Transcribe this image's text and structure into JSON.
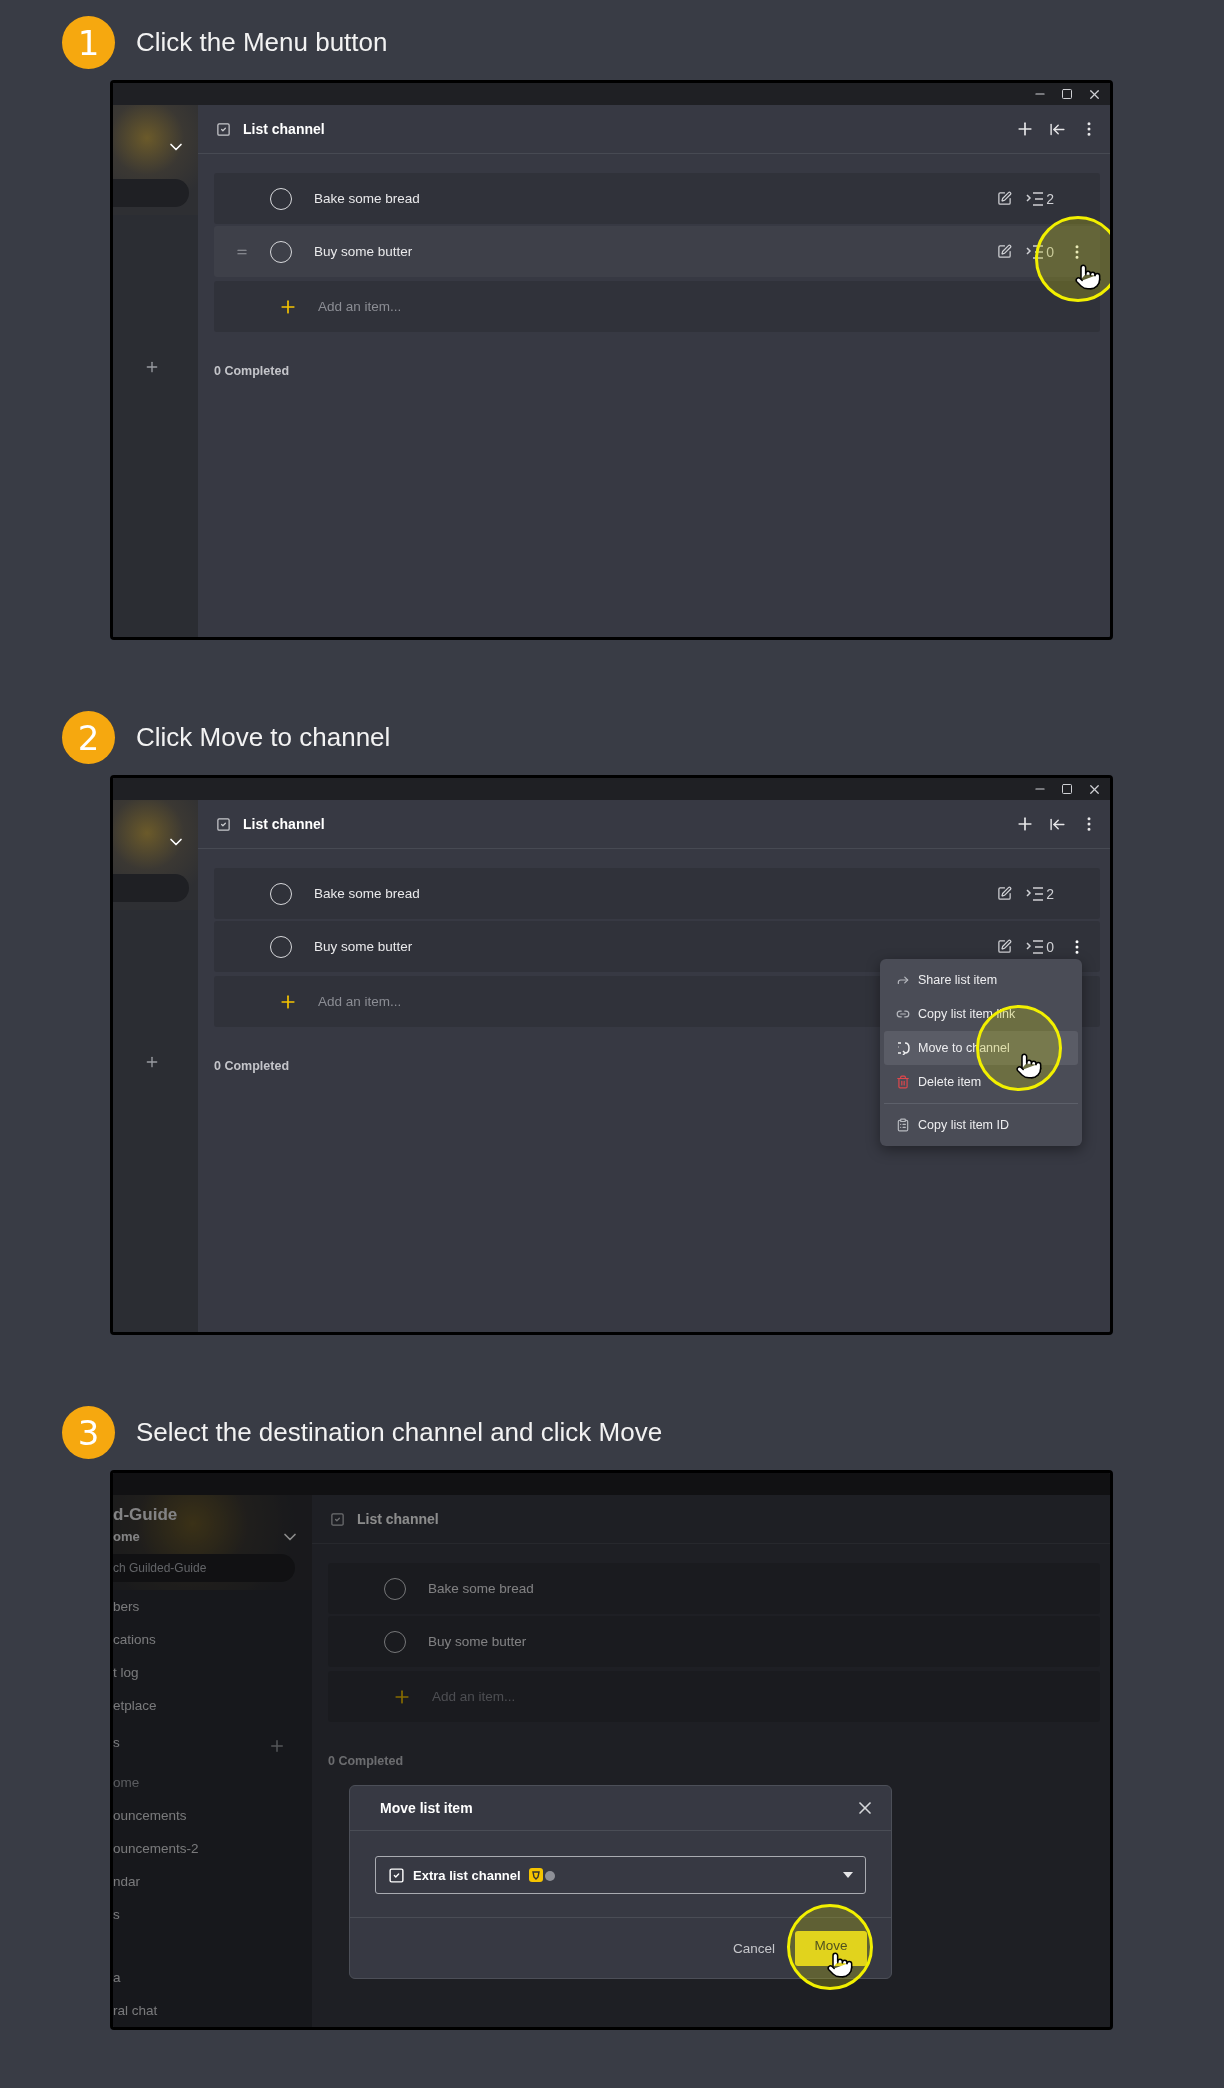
{
  "steps": [
    {
      "number": "1",
      "instruction": "Click the Menu button",
      "screen": {
        "window_controls": true,
        "channel_title": "List channel",
        "header_actions": true,
        "items": [
          {
            "label": "Bake some bread",
            "hovered": false,
            "menu_button": false,
            "click_highlight": false,
            "subtasks": "2"
          },
          {
            "label": "Buy some butter",
            "hovered": true,
            "menu_button": true,
            "click_highlight": true,
            "subtasks": "0"
          }
        ],
        "add_placeholder": "Add an item...",
        "completed": "0 Completed"
      }
    },
    {
      "number": "2",
      "instruction": "Click Move to channel",
      "screen": {
        "window_controls": true,
        "channel_title": "List channel",
        "header_actions": true,
        "items": [
          {
            "label": "Bake some bread",
            "hovered": false,
            "menu_button": false,
            "click_highlight": false,
            "subtasks": "2"
          },
          {
            "label": "Buy some butter",
            "hovered": false,
            "menu_button": true,
            "click_highlight": false,
            "subtasks": "0"
          }
        ],
        "add_placeholder": "Add an item...",
        "completed": "0 Completed",
        "menu": {
          "items": [
            {
              "kind": "share",
              "label": "Share list item",
              "selected": false,
              "divider_before": false,
              "click_highlight": false
            },
            {
              "kind": "link",
              "label": "Copy list item link",
              "selected": false,
              "divider_before": false,
              "click_highlight": false
            },
            {
              "kind": "move",
              "label": "Move to channel",
              "selected": true,
              "divider_before": false,
              "click_highlight": true
            },
            {
              "kind": "delete",
              "label": "Delete item",
              "selected": false,
              "divider_before": false,
              "click_highlight": false
            },
            {
              "kind": "copy_id",
              "label": "Copy list item ID",
              "selected": false,
              "divider_before": true,
              "click_highlight": false
            }
          ]
        }
      }
    },
    {
      "number": "3",
      "instruction": "Select the destination channel and click Move",
      "screen": {
        "window_controls": false,
        "channel_title": "List channel",
        "header_actions": false,
        "sidebar": {
          "title": "d-Guide",
          "subtitle": "ome",
          "search_value": "ch Guilded-Guide",
          "links": [
            "bers",
            "cations",
            "t log",
            "etplace"
          ],
          "section": "s",
          "channel_groups": [
            {
              "channels": [
                {
                  "label": "ome",
                  "muted": true
                },
                {
                  "label": "ouncements",
                  "muted": false
                },
                {
                  "label": "ouncements-2",
                  "muted": false
                },
                {
                  "label": "ndar",
                  "muted": false
                },
                {
                  "label": "s",
                  "muted": false
                }
              ]
            },
            {
              "channels": [
                {
                  "label": "a",
                  "muted": false
                },
                {
                  "label": "ral chat",
                  "muted": false
                }
              ]
            }
          ]
        },
        "items": [
          {
            "label": "Bake some bread",
            "hovered": false,
            "menu_button": false,
            "click_highlight": false
          },
          {
            "label": "Buy some butter",
            "hovered": false,
            "menu_button": false,
            "click_highlight": false
          }
        ],
        "add_placeholder": "Add an item...",
        "completed": "0 Completed",
        "dialog": {
          "title": "Move list item",
          "selected_channel": "Extra list channel",
          "cancel": "Cancel",
          "confirm": "Move",
          "confirm_click_highlight": true
        }
      }
    }
  ]
}
